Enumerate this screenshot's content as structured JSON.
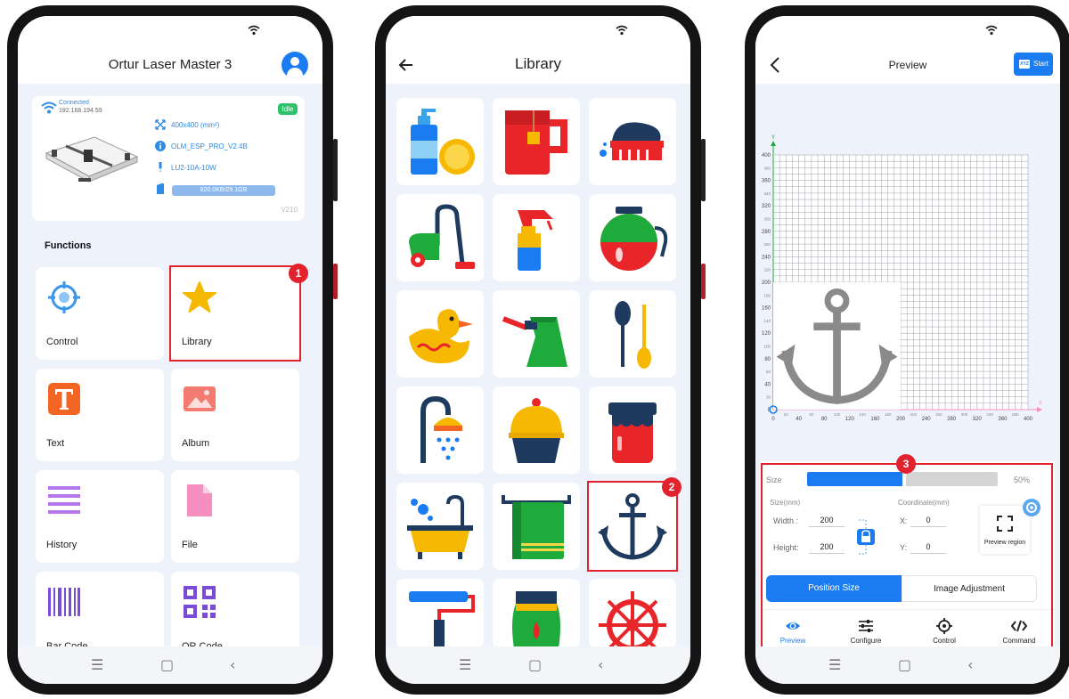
{
  "phone1": {
    "header_title": "Ortur Laser Master 3",
    "device": {
      "connection_status": "Connected",
      "ip": "192.168.194.59",
      "idle_badge": "Idle",
      "work_area": "400x400 (mm²)",
      "firmware": "OLM_ESP_PRO_V2.4B",
      "laser_module": "LU2-10A-10W",
      "storage": "820.0KB/29.1GB",
      "version": "V210"
    },
    "functions_title": "Functions",
    "functions": [
      {
        "label": "Control",
        "icon": "crosshair-icon"
      },
      {
        "label": "Library",
        "icon": "star-icon"
      },
      {
        "label": "Text",
        "icon": "text-icon"
      },
      {
        "label": "Album",
        "icon": "image-icon"
      },
      {
        "label": "History",
        "icon": "history-icon"
      },
      {
        "label": "File",
        "icon": "file-icon"
      },
      {
        "label": "Bar Code",
        "icon": "barcode-icon"
      },
      {
        "label": "QR Code",
        "icon": "qrcode-icon"
      }
    ],
    "step_badge": "1"
  },
  "phone2": {
    "header_title": "Library",
    "items": [
      "dish-soap-icon",
      "mug-icon",
      "scrub-brush-icon",
      "vacuum-icon",
      "spray-bottle-icon",
      "coffee-pot-icon",
      "rubber-duck-icon",
      "turkish-coffee-pot-icon",
      "spoons-icon",
      "shower-icon",
      "cupcake-icon",
      "jam-jar-icon",
      "bathtub-icon",
      "towel-icon",
      "anchor-icon",
      "paint-roller-icon",
      "jar-icon",
      "ship-wheel-icon"
    ],
    "step_badge": "2"
  },
  "phone3": {
    "header_title": "Preview",
    "start_button": {
      "badge": "XYZ",
      "label": "Start"
    },
    "axis": {
      "x_label": "X",
      "y_label": "Y",
      "x_ticks": [
        "0",
        "20",
        "40",
        "60",
        "80",
        "100",
        "120",
        "140",
        "160",
        "180",
        "200",
        "220",
        "240",
        "260",
        "280",
        "300",
        "320",
        "340",
        "360",
        "380",
        "400"
      ],
      "y_ticks": [
        "0",
        "20",
        "40",
        "60",
        "80",
        "100",
        "120",
        "140",
        "160",
        "180",
        "200",
        "220",
        "240",
        "260",
        "280",
        "300",
        "320",
        "340",
        "360",
        "380",
        "400"
      ]
    },
    "panel": {
      "size_label": "Size",
      "size_percent": "50%",
      "size_fraction": 0.5,
      "size_mm_label": "Size(mm)",
      "width_label": "Width :",
      "width_value": "200",
      "height_label": "Height:",
      "height_value": "200",
      "coord_label": "Coordinate(mm)",
      "x_label": "X:",
      "x_value": "0",
      "y_label": "Y:",
      "y_value": "0",
      "preview_region": "Preview region",
      "tab_active": "Position Size",
      "tab_inactive": "Image Adjustment"
    },
    "bottom_nav": [
      {
        "label": "Preview",
        "icon": "eye-icon",
        "active": true
      },
      {
        "label": "Configure",
        "icon": "sliders-icon",
        "active": false
      },
      {
        "label": "Control",
        "icon": "crosshair-icon",
        "active": false
      },
      {
        "label": "Command",
        "icon": "code-icon",
        "active": false
      }
    ],
    "step_badge": "3"
  },
  "colors": {
    "accent": "#1a7cf0",
    "highlight": "#e2232e",
    "idle": "#2ec26a"
  }
}
